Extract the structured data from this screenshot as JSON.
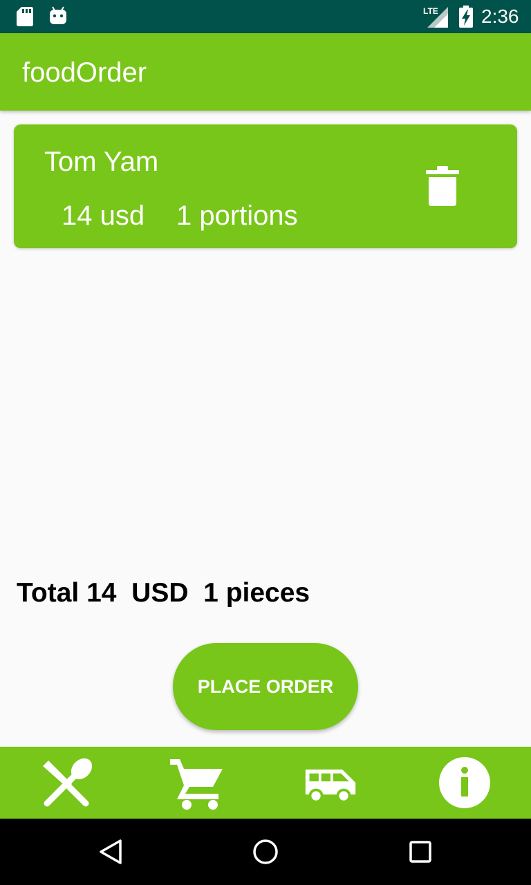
{
  "status_bar": {
    "network": "LTE",
    "time": "2:36",
    "icons": [
      "sd-card-icon",
      "android-icon",
      "lte-signal-icon",
      "battery-charging-icon"
    ]
  },
  "app_bar": {
    "title": "foodOrder"
  },
  "cart": {
    "items": [
      {
        "name": "Tom Yam",
        "price": "14 usd",
        "portions": "1 portions",
        "action_icon": "trash-icon"
      }
    ]
  },
  "total": {
    "text": "Total 14  USD  1 pieces"
  },
  "place_order": {
    "label": "PLACE ORDER"
  },
  "bottom_nav": {
    "items": [
      {
        "icon": "restaurant-icon"
      },
      {
        "icon": "cart-icon"
      },
      {
        "icon": "delivery-van-icon"
      },
      {
        "icon": "info-icon"
      }
    ]
  },
  "system_nav": {
    "buttons": [
      "back-icon",
      "home-icon",
      "recents-icon"
    ]
  },
  "colors": {
    "primary": "#78c619",
    "status_bar": "#00524a",
    "background": "#fafafa"
  }
}
